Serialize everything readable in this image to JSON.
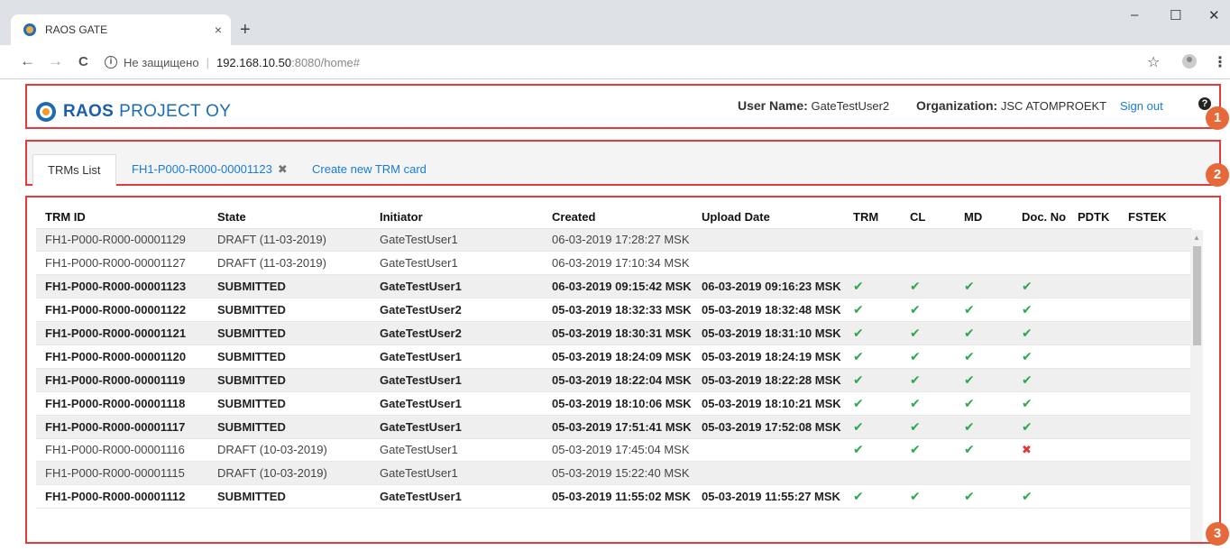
{
  "browser": {
    "tab_title": "RAOS GATE",
    "tab_close": "×",
    "new_tab": "+",
    "window": {
      "minimize": "–",
      "maximize": "☐",
      "close": "✕"
    },
    "nav": {
      "back": "←",
      "forward": "→",
      "reload": "C"
    },
    "address": {
      "info": "i",
      "insecure_label": "Не защищено",
      "separator": "|",
      "host": "192.168.10.50",
      "path": ":8080/home#"
    },
    "star": "☆",
    "menu": "⋮"
  },
  "header": {
    "logo_bold": "RAOS",
    "logo_light": "PROJECT OY",
    "user_label": "User Name:",
    "user_value": "GateTestUser2",
    "org_label": "Organization:",
    "org_value": "JSC ATOMPROEKT",
    "signout": "Sign out",
    "help": "?"
  },
  "markers": [
    "1",
    "2",
    "3"
  ],
  "tabs": {
    "list": "TRMs List",
    "open_card": "FH1-P000-R000-00001123",
    "open_card_close": "✖",
    "create": "Create new TRM card"
  },
  "grid": {
    "columns": [
      "TRM ID",
      "State",
      "Initiator",
      "Created",
      "Upload Date",
      "TRM",
      "CL",
      "MD",
      "Doc. No",
      "PDTK",
      "FSTEK"
    ],
    "check_glyph": "✔",
    "cross_glyph": "✖",
    "rows": [
      {
        "id": "FH1-P000-R000-00001129",
        "state": "DRAFT (11-03-2019)",
        "initiator": "GateTestUser1",
        "created": "06-03-2019 17:28:27 MSK",
        "upload": "",
        "trm": "",
        "cl": "",
        "md": "",
        "doc": "",
        "style": "draft"
      },
      {
        "id": "FH1-P000-R000-00001127",
        "state": "DRAFT (11-03-2019)",
        "initiator": "GateTestUser1",
        "created": "06-03-2019 17:10:34 MSK",
        "upload": "",
        "trm": "",
        "cl": "",
        "md": "",
        "doc": "",
        "style": "draft"
      },
      {
        "id": "FH1-P000-R000-00001123",
        "state": "SUBMITTED",
        "initiator": "GateTestUser1",
        "created": "06-03-2019 09:15:42 MSK",
        "upload": "06-03-2019 09:16:23 MSK",
        "trm": "check",
        "cl": "check",
        "md": "check",
        "doc": "check",
        "style": "bold"
      },
      {
        "id": "FH1-P000-R000-00001122",
        "state": "SUBMITTED",
        "initiator": "GateTestUser2",
        "created": "05-03-2019 18:32:33 MSK",
        "upload": "05-03-2019 18:32:48 MSK",
        "trm": "check",
        "cl": "check",
        "md": "check",
        "doc": "check",
        "style": "bold"
      },
      {
        "id": "FH1-P000-R000-00001121",
        "state": "SUBMITTED",
        "initiator": "GateTestUser2",
        "created": "05-03-2019 18:30:31 MSK",
        "upload": "05-03-2019 18:31:10 MSK",
        "trm": "check",
        "cl": "check",
        "md": "check",
        "doc": "check",
        "style": "bold"
      },
      {
        "id": "FH1-P000-R000-00001120",
        "state": "SUBMITTED",
        "initiator": "GateTestUser1",
        "created": "05-03-2019 18:24:09 MSK",
        "upload": "05-03-2019 18:24:19 MSK",
        "trm": "check",
        "cl": "check",
        "md": "check",
        "doc": "check",
        "style": "bold"
      },
      {
        "id": "FH1-P000-R000-00001119",
        "state": "SUBMITTED",
        "initiator": "GateTestUser1",
        "created": "05-03-2019 18:22:04 MSK",
        "upload": "05-03-2019 18:22:28 MSK",
        "trm": "check",
        "cl": "check",
        "md": "check",
        "doc": "check",
        "style": "bold"
      },
      {
        "id": "FH1-P000-R000-00001118",
        "state": "SUBMITTED",
        "initiator": "GateTestUser1",
        "created": "05-03-2019 18:10:06 MSK",
        "upload": "05-03-2019 18:10:21 MSK",
        "trm": "check",
        "cl": "check",
        "md": "check",
        "doc": "check",
        "style": "bold"
      },
      {
        "id": "FH1-P000-R000-00001117",
        "state": "SUBMITTED",
        "initiator": "GateTestUser1",
        "created": "05-03-2019 17:51:41 MSK",
        "upload": "05-03-2019 17:52:08 MSK",
        "trm": "check",
        "cl": "check",
        "md": "check",
        "doc": "check",
        "style": "bold"
      },
      {
        "id": "FH1-P000-R000-00001116",
        "state": "DRAFT (10-03-2019)",
        "initiator": "GateTestUser1",
        "created": "05-03-2019 17:45:04 MSK",
        "upload": "",
        "trm": "check",
        "cl": "check",
        "md": "check",
        "doc": "cross",
        "style": "draft"
      },
      {
        "id": "FH1-P000-R000-00001115",
        "state": "DRAFT (10-03-2019)",
        "initiator": "GateTestUser1",
        "created": "05-03-2019 15:22:40 MSK",
        "upload": "",
        "trm": "",
        "cl": "",
        "md": "",
        "doc": "",
        "style": "draft"
      },
      {
        "id": "FH1-P000-R000-00001112",
        "state": "SUBMITTED",
        "initiator": "GateTestUser1",
        "created": "05-03-2019 11:55:02 MSK",
        "upload": "05-03-2019 11:55:27 MSK",
        "trm": "check",
        "cl": "check",
        "md": "check",
        "doc": "check",
        "style": "bold"
      }
    ]
  },
  "colors": {
    "accent_link": "#1a7bd6",
    "highlight_border": "#e23b3b",
    "marker": "#e7693a",
    "check": "#2fa84f",
    "cross": "#e0333b"
  }
}
